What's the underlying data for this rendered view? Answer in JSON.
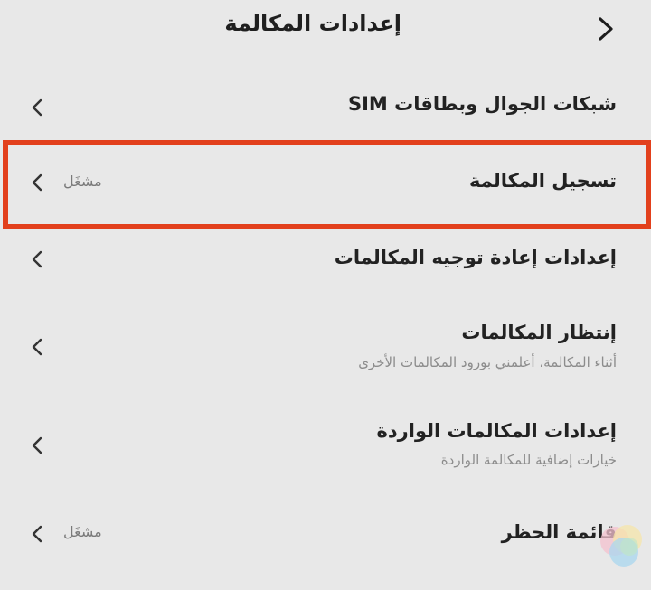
{
  "header": {
    "title": "إعدادات المكالمة",
    "back_icon": "chevron-right-icon"
  },
  "items": [
    {
      "title": "شبكات الجوال وبطاقات SIM",
      "subtitle": "",
      "status": ""
    },
    {
      "title": "تسجيل المكالمة",
      "subtitle": "",
      "status": "مشغَل",
      "highlighted": true
    },
    {
      "title": "إعدادات إعادة توجيه المكالمات",
      "subtitle": "",
      "status": ""
    },
    {
      "title": "إنتظار المكالمات",
      "subtitle": "أثناء المكالمة، أعلمني بورود المكالمات الأخرى",
      "status": ""
    },
    {
      "title": "إعدادات المكالمات الواردة",
      "subtitle": "خيارات إضافية للمكالمة الواردة",
      "status": ""
    },
    {
      "title": "قائمة الحظر",
      "subtitle": "",
      "status": "مشغَل"
    }
  ],
  "colors": {
    "background": "#e8e8e8",
    "highlight": "#e2401c"
  }
}
